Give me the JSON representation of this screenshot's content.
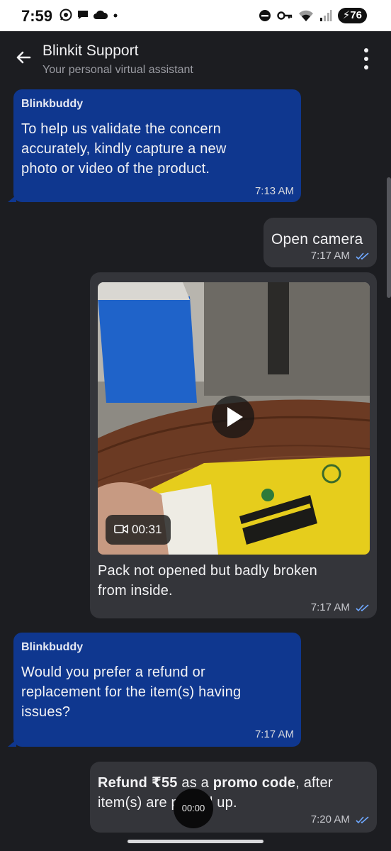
{
  "status_bar": {
    "time": "7:59",
    "battery": "76"
  },
  "header": {
    "title": "Blinkit Support",
    "subtitle": "Your personal virtual assistant"
  },
  "messages": [
    {
      "sender": "Blinkbuddy",
      "lines": [
        "To help us validate the concern",
        "accurately, kindly capture a new",
        "photo or video of the product."
      ],
      "time": "7:13 AM"
    },
    {
      "text": "Open camera",
      "time": "7:17 AM"
    },
    {
      "video_duration": "00:31",
      "lines": [
        "Pack not opened but badly broken",
        "from inside."
      ],
      "time": "7:17 AM"
    },
    {
      "sender": "Blinkbuddy",
      "lines": [
        "Would you prefer a refund or",
        "replacement for the item(s) having",
        "issues?"
      ],
      "time": "7:17 AM"
    },
    {
      "bold1": "Refund ₹55",
      "plain1": " as a ",
      "bold2": "promo code",
      "plain2": ", after",
      "line2_a": "item(s) are ",
      "line2_b": "picked up.",
      "time": "7:20 AM"
    }
  ],
  "recording_timer": "00:00",
  "colors": {
    "bot_bubble": "#0f378f",
    "user_bubble": "#34353a",
    "background": "#1c1d21",
    "read_ticks": "#6fa8ff"
  },
  "icons": [
    "back-arrow-icon",
    "more-vert-icon",
    "whatsapp-icon",
    "chat-icon",
    "cloud-icon",
    "dnd-icon",
    "key-icon",
    "wifi-icon",
    "signal-icon",
    "play-icon",
    "video-camera-icon",
    "double-tick-icon"
  ]
}
